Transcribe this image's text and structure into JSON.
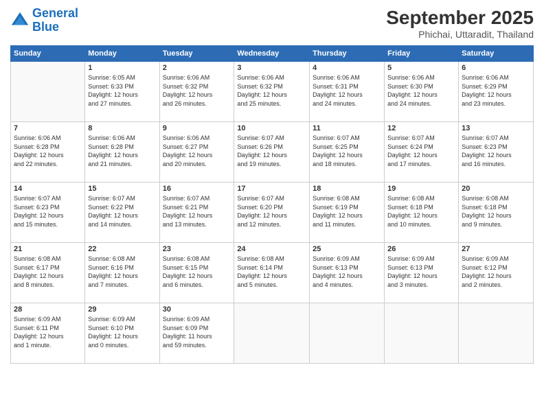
{
  "logo": {
    "text_general": "General",
    "text_blue": "Blue"
  },
  "header": {
    "month": "September 2025",
    "location": "Phichai, Uttaradit, Thailand"
  },
  "weekdays": [
    "Sunday",
    "Monday",
    "Tuesday",
    "Wednesday",
    "Thursday",
    "Friday",
    "Saturday"
  ],
  "weeks": [
    [
      {
        "day": "",
        "info": ""
      },
      {
        "day": "1",
        "info": "Sunrise: 6:05 AM\nSunset: 6:33 PM\nDaylight: 12 hours\nand 27 minutes."
      },
      {
        "day": "2",
        "info": "Sunrise: 6:06 AM\nSunset: 6:32 PM\nDaylight: 12 hours\nand 26 minutes."
      },
      {
        "day": "3",
        "info": "Sunrise: 6:06 AM\nSunset: 6:32 PM\nDaylight: 12 hours\nand 25 minutes."
      },
      {
        "day": "4",
        "info": "Sunrise: 6:06 AM\nSunset: 6:31 PM\nDaylight: 12 hours\nand 24 minutes."
      },
      {
        "day": "5",
        "info": "Sunrise: 6:06 AM\nSunset: 6:30 PM\nDaylight: 12 hours\nand 24 minutes."
      },
      {
        "day": "6",
        "info": "Sunrise: 6:06 AM\nSunset: 6:29 PM\nDaylight: 12 hours\nand 23 minutes."
      }
    ],
    [
      {
        "day": "7",
        "info": "Sunrise: 6:06 AM\nSunset: 6:28 PM\nDaylight: 12 hours\nand 22 minutes."
      },
      {
        "day": "8",
        "info": "Sunrise: 6:06 AM\nSunset: 6:28 PM\nDaylight: 12 hours\nand 21 minutes."
      },
      {
        "day": "9",
        "info": "Sunrise: 6:06 AM\nSunset: 6:27 PM\nDaylight: 12 hours\nand 20 minutes."
      },
      {
        "day": "10",
        "info": "Sunrise: 6:07 AM\nSunset: 6:26 PM\nDaylight: 12 hours\nand 19 minutes."
      },
      {
        "day": "11",
        "info": "Sunrise: 6:07 AM\nSunset: 6:25 PM\nDaylight: 12 hours\nand 18 minutes."
      },
      {
        "day": "12",
        "info": "Sunrise: 6:07 AM\nSunset: 6:24 PM\nDaylight: 12 hours\nand 17 minutes."
      },
      {
        "day": "13",
        "info": "Sunrise: 6:07 AM\nSunset: 6:23 PM\nDaylight: 12 hours\nand 16 minutes."
      }
    ],
    [
      {
        "day": "14",
        "info": "Sunrise: 6:07 AM\nSunset: 6:23 PM\nDaylight: 12 hours\nand 15 minutes."
      },
      {
        "day": "15",
        "info": "Sunrise: 6:07 AM\nSunset: 6:22 PM\nDaylight: 12 hours\nand 14 minutes."
      },
      {
        "day": "16",
        "info": "Sunrise: 6:07 AM\nSunset: 6:21 PM\nDaylight: 12 hours\nand 13 minutes."
      },
      {
        "day": "17",
        "info": "Sunrise: 6:07 AM\nSunset: 6:20 PM\nDaylight: 12 hours\nand 12 minutes."
      },
      {
        "day": "18",
        "info": "Sunrise: 6:08 AM\nSunset: 6:19 PM\nDaylight: 12 hours\nand 11 minutes."
      },
      {
        "day": "19",
        "info": "Sunrise: 6:08 AM\nSunset: 6:18 PM\nDaylight: 12 hours\nand 10 minutes."
      },
      {
        "day": "20",
        "info": "Sunrise: 6:08 AM\nSunset: 6:18 PM\nDaylight: 12 hours\nand 9 minutes."
      }
    ],
    [
      {
        "day": "21",
        "info": "Sunrise: 6:08 AM\nSunset: 6:17 PM\nDaylight: 12 hours\nand 8 minutes."
      },
      {
        "day": "22",
        "info": "Sunrise: 6:08 AM\nSunset: 6:16 PM\nDaylight: 12 hours\nand 7 minutes."
      },
      {
        "day": "23",
        "info": "Sunrise: 6:08 AM\nSunset: 6:15 PM\nDaylight: 12 hours\nand 6 minutes."
      },
      {
        "day": "24",
        "info": "Sunrise: 6:08 AM\nSunset: 6:14 PM\nDaylight: 12 hours\nand 5 minutes."
      },
      {
        "day": "25",
        "info": "Sunrise: 6:09 AM\nSunset: 6:13 PM\nDaylight: 12 hours\nand 4 minutes."
      },
      {
        "day": "26",
        "info": "Sunrise: 6:09 AM\nSunset: 6:13 PM\nDaylight: 12 hours\nand 3 minutes."
      },
      {
        "day": "27",
        "info": "Sunrise: 6:09 AM\nSunset: 6:12 PM\nDaylight: 12 hours\nand 2 minutes."
      }
    ],
    [
      {
        "day": "28",
        "info": "Sunrise: 6:09 AM\nSunset: 6:11 PM\nDaylight: 12 hours\nand 1 minute."
      },
      {
        "day": "29",
        "info": "Sunrise: 6:09 AM\nSunset: 6:10 PM\nDaylight: 12 hours\nand 0 minutes."
      },
      {
        "day": "30",
        "info": "Sunrise: 6:09 AM\nSunset: 6:09 PM\nDaylight: 11 hours\nand 59 minutes."
      },
      {
        "day": "",
        "info": ""
      },
      {
        "day": "",
        "info": ""
      },
      {
        "day": "",
        "info": ""
      },
      {
        "day": "",
        "info": ""
      }
    ]
  ]
}
